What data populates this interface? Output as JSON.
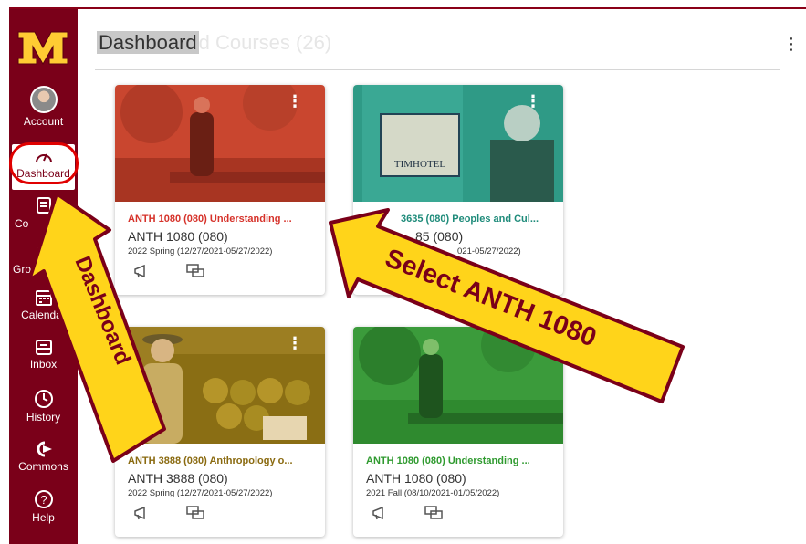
{
  "nav": {
    "logo_label": "M",
    "items": [
      {
        "label": "Account",
        "icon": "avatar-icon"
      },
      {
        "label": "Dashboard",
        "icon": "speedometer-icon"
      },
      {
        "label": "Co",
        "icon": "courses-icon"
      },
      {
        "label": "Grou",
        "icon": "groups-icon"
      },
      {
        "label": "Calendar",
        "icon": "calendar-icon"
      },
      {
        "label": "Inbox",
        "icon": "inbox-icon"
      },
      {
        "label": "History",
        "icon": "clock-icon"
      },
      {
        "label": "Commons",
        "icon": "commons-icon"
      },
      {
        "label": "Help",
        "icon": "help-icon"
      }
    ]
  },
  "header": {
    "title": "Dashboard",
    "faded_title": "d Courses (26)",
    "options_icon": "kebab-icon"
  },
  "cards": [
    {
      "link": "ANTH 1080 (080) Understanding ...",
      "code": "ANTH 1080 (080)",
      "term": "2022 Spring (12/27/2021-05/27/2022)",
      "color": "#d6322a"
    },
    {
      "link": "3635 (080) Peoples and Cul...",
      "code": "85 (080)",
      "term": "021-05/27/2022)",
      "color": "#1e8b7a"
    },
    {
      "link": "ANTH 3888 (080) Anthropology o...",
      "code": "ANTH 3888 (080)",
      "term": "2022 Spring (12/27/2021-05/27/2022)",
      "color": "#8a6a10"
    },
    {
      "link": "ANTH 1080 (080) Understanding ...",
      "code": "ANTH 1080 (080)",
      "term": "2021 Fall (08/10/2021-01/05/2022)",
      "color": "#2f9a2f"
    }
  ],
  "annotations": {
    "arrow_dashboard": "Dashboard",
    "arrow_select": "Select ANTH 1080"
  },
  "colors": {
    "brand": "#7a0019",
    "gold": "#ffcc33",
    "annotation_fill": "#ffd41a",
    "annotation_stroke": "#7a0019"
  }
}
